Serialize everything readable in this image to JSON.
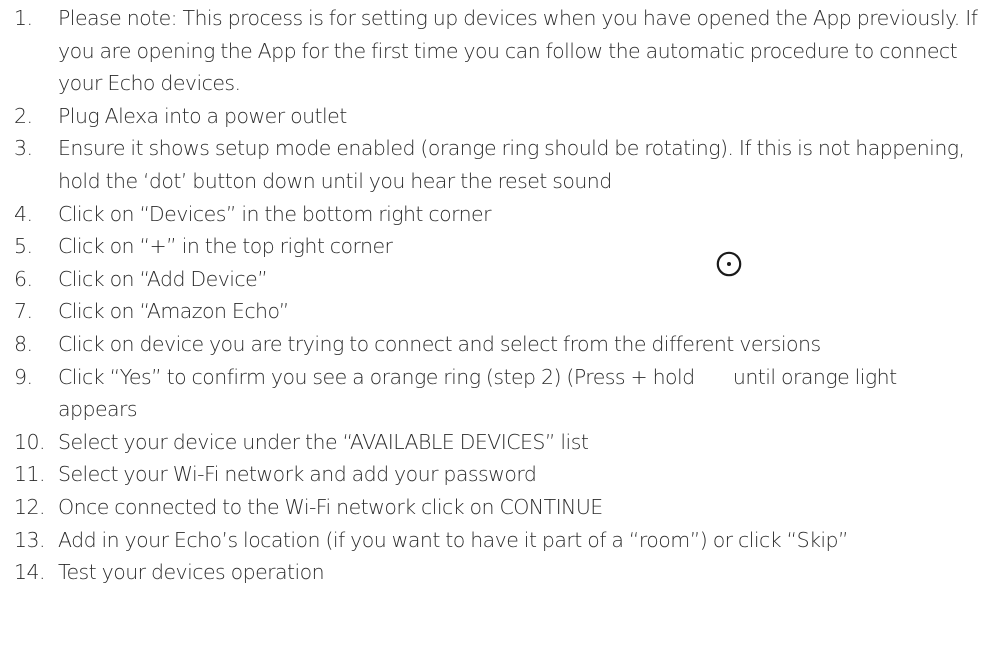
{
  "steps": [
    {
      "number": "1.",
      "text": "Please note: This process is for setting up devices when you have opened the App previously. If you are opening the App for the first time you can follow the automatic procedure to connect your Echo devices."
    },
    {
      "number": "2.",
      "text": "Plug Alexa into a power outlet"
    },
    {
      "number": "3.",
      "text": "Ensure it shows setup mode enabled (orange ring should be rotating). If this is not happening, hold the ‘dot’ button down until you hear the reset sound"
    },
    {
      "number": "4.",
      "text": "Click on “Devices” in the bottom right corner"
    },
    {
      "number": "5.",
      "text": "Click on “+” in the top right corner"
    },
    {
      "number": "6.",
      "text": "Click on “Add Device”"
    },
    {
      "number": "7.",
      "text": "Click on “Amazon Echo”"
    },
    {
      "number": "8.",
      "text": "Click on device you are trying to connect and select from the different versions"
    },
    {
      "number": "9.",
      "text": "Click “Yes” to confirm you see a orange ring (step 2) (Press + hold       until orange light appears"
    },
    {
      "number": "10.",
      "text": "Select your device under the “AVAILABLE DEVICES” list"
    },
    {
      "number": "11.",
      "text": "Select your Wi-Fi network and add your password"
    },
    {
      "number": "12.",
      "text": "Once connected to the Wi-Fi network click on CONTINUE"
    },
    {
      "number": "13.",
      "text": "Add in your Echo’s location (if you want to have it part of a “room”) or click “Skip”"
    },
    {
      "number": "14.",
      "text": "Test your devices operation"
    }
  ],
  "icons": {
    "dot_button": "dot-button-icon"
  }
}
